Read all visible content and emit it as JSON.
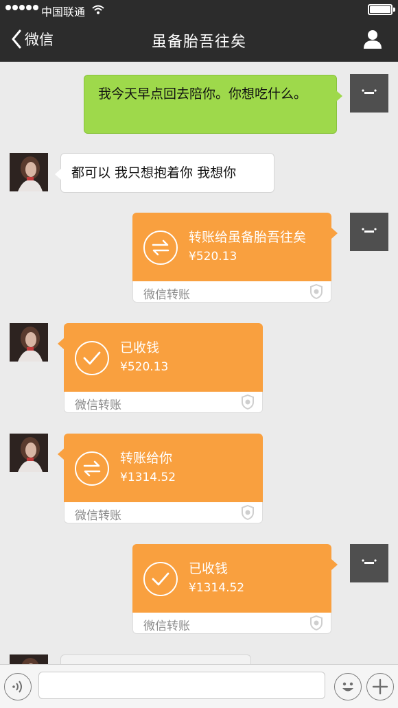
{
  "status_bar": {
    "carrier": "中国联通"
  },
  "header": {
    "back_label": "微信",
    "title": "虽备胎吾往矣"
  },
  "messages": [
    {
      "side": "right",
      "type": "text",
      "text": "我今天早点回去陪你。你想吃什么。"
    },
    {
      "side": "left",
      "type": "text",
      "text": "都可以 我只想抱着你 我想你"
    },
    {
      "side": "right",
      "type": "transfer",
      "icon": "transfer-icon",
      "title": "转账给虽备胎吾往矣",
      "amount": "¥520.13",
      "footer": "微信转账"
    },
    {
      "side": "left",
      "type": "transfer",
      "icon": "check-icon",
      "title": "已收钱",
      "amount": "¥520.13",
      "footer": "微信转账"
    },
    {
      "side": "left",
      "type": "transfer",
      "icon": "transfer-icon",
      "title": "转账给你",
      "amount": "¥1314.52",
      "footer": "微信转账"
    },
    {
      "side": "right",
      "type": "transfer",
      "icon": "check-icon",
      "title": "已收钱",
      "amount": "¥1314.52",
      "footer": "微信转账"
    }
  ],
  "input_bar": {
    "placeholder": ""
  },
  "colors": {
    "header_bg": "#2c2c2c",
    "chat_bg": "#ebebeb",
    "green_bubble": "#9ed94b",
    "transfer_orange": "#f9a03f"
  }
}
